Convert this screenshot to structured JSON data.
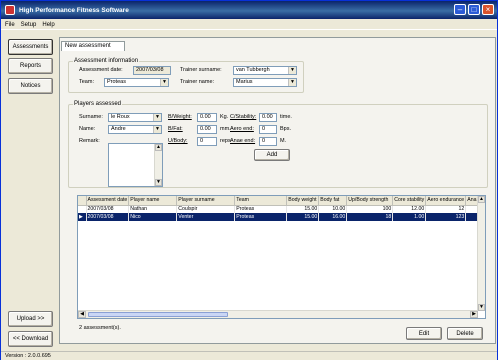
{
  "window": {
    "title": "High Performance Fitness Software"
  },
  "menu": [
    "File",
    "Setup",
    "Help"
  ],
  "nav": {
    "assessments": "Assessments",
    "reports": "Reports",
    "notices": "Notices",
    "upload": "Upload >>",
    "download": "<< Download"
  },
  "tab": {
    "label": "New assessment"
  },
  "assessment_info": {
    "title": "Assessment information",
    "date_label": "Assessment date:",
    "date_value": "2007/03/08",
    "team_label": "Team:",
    "team_value": "Proteas",
    "trainer_surname_label": "Trainer surname:",
    "trainer_surname_value": "van Tubbergh",
    "trainer_name_label": "Trainer name:",
    "trainer_name_value": "Marius"
  },
  "players": {
    "title": "Players assessed",
    "surname_label": "Surname:",
    "surname_value": "le Roux",
    "name_label": "Name:",
    "name_value": "Andre",
    "remark_label": "Remark:",
    "bweight_label": "B/Weight:",
    "bweight_value": "0.00",
    "bweight_unit": "Kg.",
    "bfat_label": "B/Fat:",
    "bfat_value": "0.00",
    "bfat_unit": "mm.",
    "ubody_label": "U/Body:",
    "ubody_value": "0",
    "ubody_unit": "reps",
    "cstab_label": "C/Stability:",
    "cstab_value": "0.00",
    "cstab_unit": "time.",
    "aero_label": "Aero end:",
    "aero_value": "0",
    "aero_unit": "Bps.",
    "anae_label": "Anae end:",
    "anae_value": "0",
    "anae_unit": "M.",
    "add_label": "Add"
  },
  "grid": {
    "columns": [
      "Assessment date",
      "Player name",
      "Player surname",
      "Team",
      "Body weight",
      "Body fat",
      "Up/Body strength",
      "Core stability",
      "Aero endurance",
      "Ana"
    ],
    "rows": [
      [
        "2007/03/08",
        "Nathan",
        "Coulspir",
        "Proteas",
        "15.00",
        "10.00",
        "100",
        "12.00",
        "12"
      ],
      [
        "2007/03/08",
        "Nico",
        "Venter",
        "Proteas",
        "15.00",
        "16.00",
        "18",
        "1.00",
        "123"
      ]
    ],
    "selected_row": 1,
    "count_text": "2 assessment(s)."
  },
  "actions": {
    "edit": "Edit",
    "delete": "Delete"
  },
  "status": "Version : 2.0.0.695"
}
